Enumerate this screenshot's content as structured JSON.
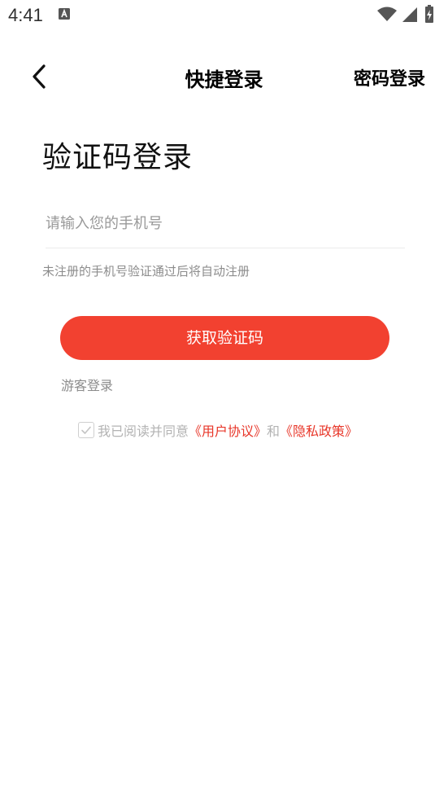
{
  "status_bar": {
    "time": "4:41",
    "icons": [
      "notification-a-icon",
      "wifi-icon",
      "signal-icon",
      "battery-icon"
    ]
  },
  "header": {
    "back_icon": "chevron-left-icon",
    "title": "快捷登录",
    "password_login_label": "密码登录"
  },
  "main": {
    "page_title": "验证码登录",
    "phone_input": {
      "placeholder": "请输入您的手机号",
      "value": ""
    },
    "hint": "未注册的手机号验证通过后将自动注册",
    "get_code_label": "获取验证码",
    "guest_login_label": "游客登录"
  },
  "agreement": {
    "checked": true,
    "prefix": "我已阅读并同意",
    "user_agreement": "《用户协议》",
    "conjunction": "和",
    "privacy_policy": "《隐私政策》"
  },
  "colors": {
    "accent": "#f24130",
    "link": "#e8372a",
    "hint": "#8c8c8c"
  }
}
